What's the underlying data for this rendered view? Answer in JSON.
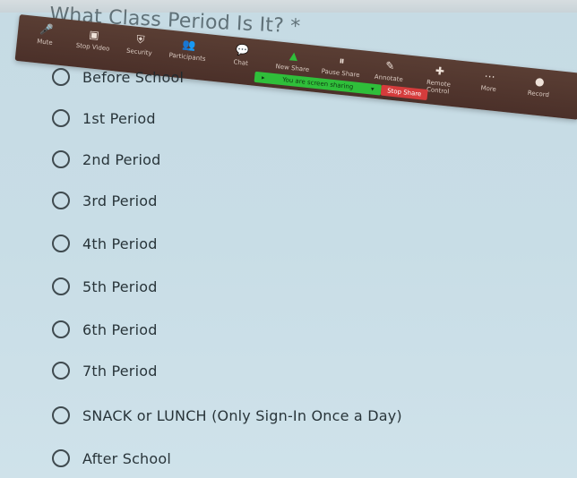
{
  "form": {
    "question_title": "What Class Period Is It? *",
    "options": [
      {
        "label": "Before School"
      },
      {
        "label": "1st Period"
      },
      {
        "label": "2nd Period"
      },
      {
        "label": "3rd Period"
      },
      {
        "label": "4th Period"
      },
      {
        "label": "5th Period"
      },
      {
        "label": "6th Period"
      },
      {
        "label": "7th Period"
      },
      {
        "label": "SNACK or LUNCH (Only Sign-In Once a Day)"
      },
      {
        "label": "After School"
      }
    ]
  },
  "meeting_toolbar": {
    "items": [
      {
        "label": "Mute",
        "icon": "microphone-icon"
      },
      {
        "label": "Stop Video",
        "icon": "video-camera-icon"
      },
      {
        "label": "Security",
        "icon": "shield-icon"
      },
      {
        "label": "Participants",
        "icon": "participants-icon"
      },
      {
        "label": "Chat",
        "icon": "chat-icon"
      },
      {
        "label": "New Share",
        "icon": "new-share-icon"
      },
      {
        "label": "Pause Share",
        "icon": "pause-icon"
      },
      {
        "label": "Annotate",
        "icon": "annotate-icon"
      },
      {
        "label": "Remote Control",
        "icon": "remote-control-icon"
      },
      {
        "label": "More",
        "icon": "more-icon"
      },
      {
        "label": "Record",
        "icon": "record-icon"
      }
    ],
    "share_banner_text": "You are screen sharing",
    "stop_share_label": "Stop Share",
    "colors": {
      "toolbar_bg": "#4b3029",
      "share_banner_bg": "#2fbf3a",
      "stop_share_bg": "#d53c3c"
    }
  }
}
